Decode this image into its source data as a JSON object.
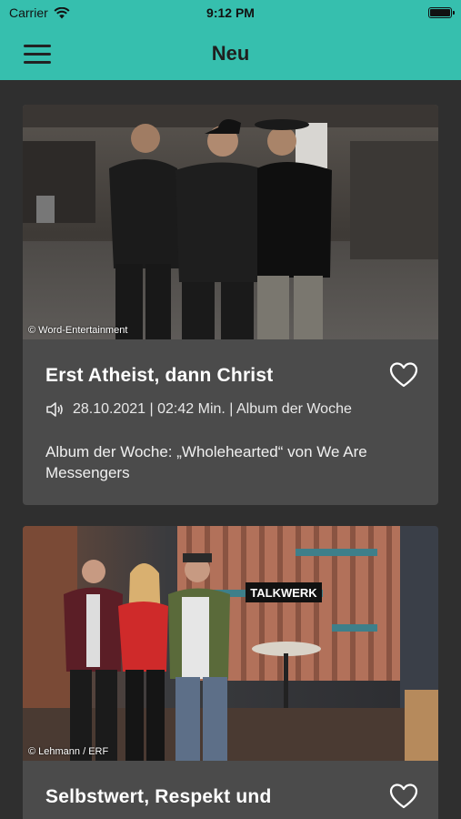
{
  "status": {
    "carrier": "Carrier",
    "time": "9:12 PM"
  },
  "nav": {
    "title": "Neu"
  },
  "articles": [
    {
      "image_credit": "© Word-Entertainment",
      "title": "Erst Atheist, dann Christ",
      "meta": "28.10.2021 | 02:42 Min. | Album der Woche",
      "description": "Album der Woche: „Wholehearted“ von We Are Messengers"
    },
    {
      "image_credit": "© Lehmann / ERF",
      "title": "Selbstwert, Respekt und",
      "sign_text": "TALKWERK"
    }
  ],
  "colors": {
    "accent": "#36bfae",
    "background": "#2f2f2f",
    "card": "#4b4b4b"
  }
}
